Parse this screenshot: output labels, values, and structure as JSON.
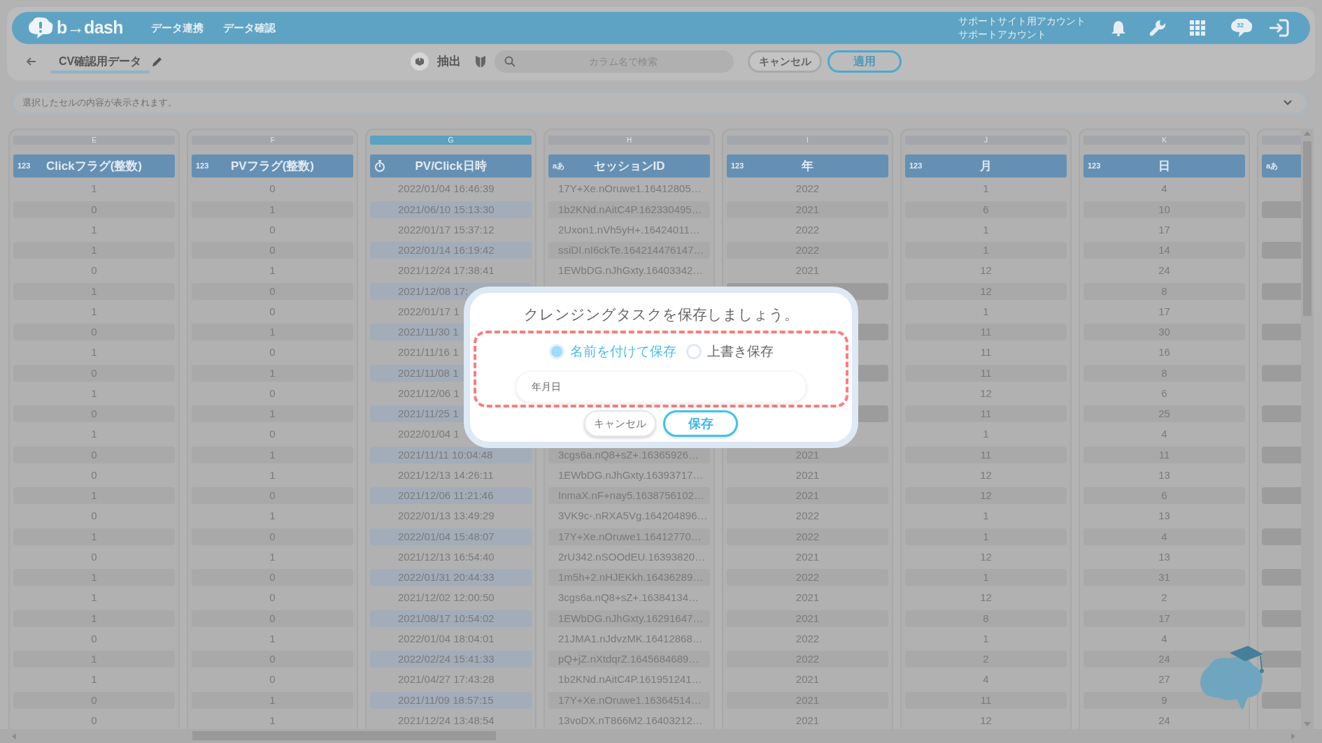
{
  "header": {
    "logo": "b→dash",
    "nav": [
      {
        "label": "データ連携"
      },
      {
        "label": "データ確認"
      }
    ],
    "account": [
      "サポートサイト用アカウント",
      "サポートアカウント"
    ],
    "chat_badge": "32"
  },
  "toolbar": {
    "title": "CV確認用データ",
    "extract_label": "抽出",
    "search": {
      "placeholder": "カラム名で検索"
    },
    "buttons": [
      {
        "label": "キャンセル",
        "kind": "plain"
      },
      {
        "label": "適用",
        "kind": "primary"
      }
    ]
  },
  "cell_preview": {
    "placeholder": "選択したセルの内容が表示されます。"
  },
  "table": {
    "columns": [
      {
        "letter": "E",
        "name": "Clickフラグ(整数)",
        "kind": "number",
        "type_mark": "123",
        "selected": false
      },
      {
        "letter": "F",
        "name": "PVフラグ(整数)",
        "kind": "number",
        "type_mark": "123",
        "selected": false
      },
      {
        "letter": "G",
        "name": "PV/Click日時",
        "kind": "datetime",
        "selected": true
      },
      {
        "letter": "H",
        "name": "セッションID",
        "kind": "text",
        "type_mark": "aあ",
        "selected": false
      },
      {
        "letter": "I",
        "name": "年",
        "kind": "number",
        "type_mark": "123",
        "selected": false
      },
      {
        "letter": "J",
        "name": "月",
        "kind": "number",
        "type_mark": "123",
        "selected": false
      },
      {
        "letter": "K",
        "name": "日",
        "kind": "number",
        "type_mark": "123",
        "selected": false
      },
      {
        "kind": "text",
        "type_mark": "aあ",
        "selected": false
      }
    ],
    "rows": [
      [
        "1",
        "0",
        "2022/01/04 16:46:39",
        "17Y+Xe.nOruwe1.16412805…",
        "2022",
        "1",
        "4"
      ],
      [
        "0",
        "1",
        "2021/06/10 15:13:30",
        "1b2KNd.nAitC4P.162330495…",
        "2021",
        "6",
        "10"
      ],
      [
        "1",
        "0",
        "2022/01/17 15:37:12",
        "2Uxon1.nVh5yH+.16424011…",
        "2022",
        "1",
        "17"
      ],
      [
        "1",
        "0",
        "2022/01/14 16:19:42",
        "ssiDI.nI6ckTe.164214476147…",
        "2022",
        "1",
        "14"
      ],
      [
        "0",
        "1",
        "2021/12/24 17:38:41",
        "1EWbDG.nJhGxty.16403342…",
        "2021",
        "12",
        "24"
      ],
      [
        "1",
        "0",
        "2021/12/08 17:",
        null,
        null,
        "12",
        "8"
      ],
      [
        "1",
        "0",
        "2022/01/17 1",
        null,
        null,
        "1",
        "17"
      ],
      [
        "0",
        "1",
        "2021/11/30 1",
        null,
        null,
        "11",
        "30"
      ],
      [
        "1",
        "0",
        "2021/11/16 1",
        null,
        null,
        "11",
        "16"
      ],
      [
        "0",
        "1",
        "2021/11/08 1",
        null,
        null,
        "11",
        "8"
      ],
      [
        "1",
        "0",
        "2021/12/06 1",
        null,
        null,
        "12",
        "6"
      ],
      [
        "0",
        "1",
        "2021/11/25 1",
        null,
        null,
        "11",
        "25"
      ],
      [
        "1",
        "0",
        "2022/01/04 1",
        null,
        null,
        "1",
        "4"
      ],
      [
        "0",
        "1",
        "2021/11/11 10:04:48",
        "3cgs6a.nQ8+sZ+.16365926…",
        "2021",
        "11",
        "11"
      ],
      [
        "0",
        "1",
        "2021/12/13 14:26:11",
        "1EWbDG.nJhGxty.16393717…",
        "2021",
        "12",
        "13"
      ],
      [
        "1",
        "0",
        "2021/12/06 11:21:46",
        "InmaX.nF+nay5.1638756102…",
        "2021",
        "12",
        "6"
      ],
      [
        "0",
        "1",
        "2022/01/13 13:49:29",
        "3VK9c-.nRXA5Vg.164204896…",
        "2022",
        "1",
        "13"
      ],
      [
        "1",
        "0",
        "2022/01/04 15:48:07",
        "17Y+Xe.nOruwe1.16412770…",
        "2022",
        "1",
        "4"
      ],
      [
        "0",
        "1",
        "2021/12/13 16:54:40",
        "2rU342.nSOOdEU.16393820…",
        "2021",
        "12",
        "13"
      ],
      [
        "1",
        "0",
        "2022/01/31 20:44:33",
        "1m5h+2.nHJEKkh.16436289…",
        "2022",
        "1",
        "31"
      ],
      [
        "1",
        "0",
        "2021/12/02 12:00:50",
        "3cgs6a.nQ8+sZ+.16384134…",
        "2021",
        "12",
        "2"
      ],
      [
        "1",
        "0",
        "2021/08/17 10:54:02",
        "1EWbDG.nJhGxty.16291647…",
        "2021",
        "8",
        "17"
      ],
      [
        "0",
        "1",
        "2022/01/04 18:04:01",
        "21JMA1.nJdvzMK.16412868…",
        "2022",
        "1",
        "4"
      ],
      [
        "1",
        "0",
        "2022/02/24 15:41:33",
        "pQ+jZ.nXtdqrZ.1645684689…",
        "2022",
        "2",
        "24"
      ],
      [
        "1",
        "0",
        "2021/04/27 17:43:28",
        "1b2KNd.nAitC4P.161951241…",
        "2021",
        "4",
        "27"
      ],
      [
        "0",
        "1",
        "2021/11/09 18:57:15",
        "17Y+Xe.nOruwe1.16364514…",
        "2021",
        "11",
        "9"
      ],
      [
        "0",
        "1",
        "2021/12/24 13:48:54",
        "13voDX.nT866M2.16403212…",
        "2021",
        "12",
        "24"
      ]
    ]
  },
  "dialog": {
    "title": "クレンジングタスクを保存しましょう。",
    "options": [
      {
        "label": "名前を付けて保存",
        "selected": true
      },
      {
        "label": "上書き保存",
        "selected": false
      }
    ],
    "name_field": {
      "value": "年月日"
    },
    "buttons": [
      {
        "label": "キャンセル",
        "kind": "plain"
      },
      {
        "label": "保存",
        "kind": "primary"
      }
    ]
  }
}
